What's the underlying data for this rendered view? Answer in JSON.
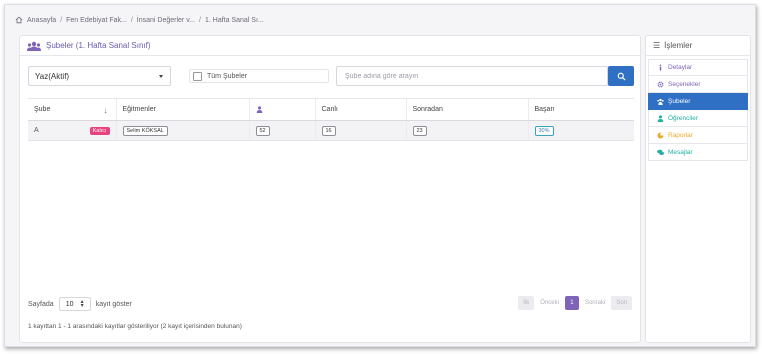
{
  "breadcrumb": [
    "Anasayfa",
    "Fen Edebiyat Fak...",
    "İnsani Değerler v...",
    "1. Hafta Sanal Sı..."
  ],
  "panel": {
    "title": "Şubeler (1. Hafta Sanal Sınıf)"
  },
  "controls": {
    "term_select": "Yaz(Aktif)",
    "all_branches_label": "Tüm Şubeler",
    "search_placeholder": "Şube adına göre arayın"
  },
  "table": {
    "headers": {
      "branch": "Şube",
      "instructors": "Eğitmenler",
      "live": "Canlı",
      "later": "Sonradan",
      "success": "Başarı"
    },
    "rows": [
      {
        "branch": "A",
        "badge": "Kalıcı",
        "instructor": "Selim KÖKSAL",
        "students": "52",
        "live": "16",
        "later": "23",
        "success": "30%"
      }
    ]
  },
  "footer": {
    "page_label": "Sayfada",
    "page_size": "10",
    "show_label": "kayıt göster",
    "first": "İlk",
    "prev": "Önceki",
    "current": "1",
    "next": "Sonraki",
    "last": "Son",
    "summary": "1 kayıttan 1 - 1 arasındaki kayıtlar gösteriliyor (2 kayıt içerisinden bulunan)"
  },
  "sidebar": {
    "title": "İşlemler",
    "items": [
      {
        "label": "Detaylar",
        "color": "#7e63b9",
        "icon": "info-icon"
      },
      {
        "label": "Seçenekler",
        "color": "#7e63b9",
        "icon": "gear-icon"
      },
      {
        "label": "Şubeler",
        "color": "#ffffff",
        "icon": "users-icon"
      },
      {
        "label": "Öğrenciler",
        "color": "#23b0a0",
        "icon": "user-icon"
      },
      {
        "label": "Raporlar",
        "color": "#f0a830",
        "icon": "pie-icon"
      },
      {
        "label": "Mesajlar",
        "color": "#23b0a0",
        "icon": "comments-icon"
      }
    ]
  },
  "colors": {
    "accent": "#7e63b9",
    "primary": "#2f6fc4",
    "badge": "#e8437f"
  }
}
